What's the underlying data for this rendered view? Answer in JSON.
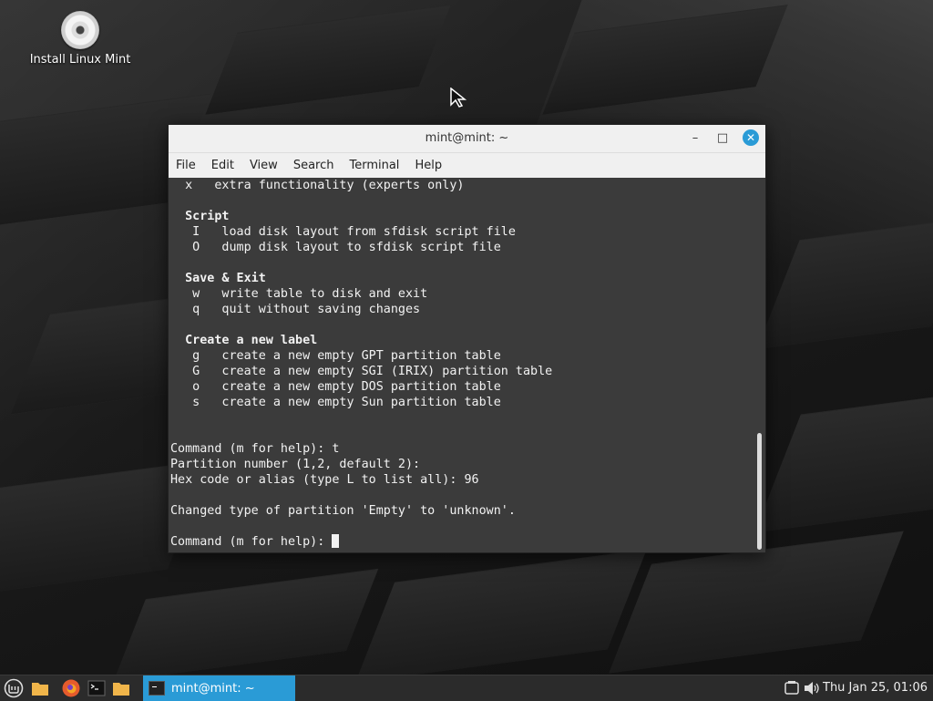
{
  "desktop": {
    "icon_label": "Install Linux Mint"
  },
  "window": {
    "title": "mint@mint: ~",
    "controls": {
      "minimize": "–",
      "maximize": "□",
      "close": "✕"
    },
    "menu": [
      "File",
      "Edit",
      "View",
      "Search",
      "Terminal",
      "Help"
    ]
  },
  "terminal": {
    "lines": [
      "  x   extra functionality (experts only)",
      "",
      "  Script",
      "   I   load disk layout from sfdisk script file",
      "   O   dump disk layout to sfdisk script file",
      "",
      "  Save & Exit",
      "   w   write table to disk and exit",
      "   q   quit without saving changes",
      "",
      "  Create a new label",
      "   g   create a new empty GPT partition table",
      "   G   create a new empty SGI (IRIX) partition table",
      "   o   create a new empty DOS partition table",
      "   s   create a new empty Sun partition table",
      "",
      "",
      "Command (m for help): t",
      "Partition number (1,2, default 2):",
      "Hex code or alias (type L to list all): 96",
      "",
      "Changed type of partition 'Empty' to 'unknown'.",
      "",
      "Command (m for help): "
    ],
    "bold_lines": [
      2,
      6,
      10
    ]
  },
  "taskbar": {
    "launchers": [
      "mint-menu-icon",
      "files-icon",
      "firefox-icon",
      "terminal-icon",
      "folder-icon"
    ],
    "active_task": "mint@mint: ~",
    "clock": "Thu Jan 25, 01:06"
  }
}
